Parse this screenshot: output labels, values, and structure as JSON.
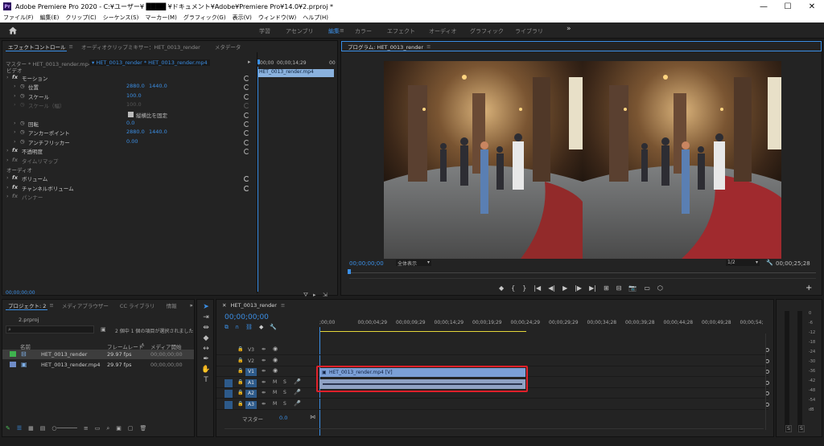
{
  "titlebar": {
    "logo_text": "Pr",
    "title": "Adobe Premiere Pro 2020 - C:¥ユーザー¥ ████ ¥ドキュメント¥Adobe¥Premiere Pro¥14.0¥2.prproj *",
    "min": "—",
    "max": "☐",
    "close": "✕"
  },
  "menu": [
    "ファイル(F)",
    "編集(E)",
    "クリップ(C)",
    "シーケンス(S)",
    "マーカー(M)",
    "グラフィック(G)",
    "表示(V)",
    "ウィンドウ(W)",
    "ヘルプ(H)"
  ],
  "workspaces": {
    "items": [
      "学習",
      "アセンブリ",
      "編集",
      "カラー",
      "エフェクト",
      "オーディオ",
      "グラフィック",
      "ライブラリ"
    ],
    "more": "»"
  },
  "effect_controls": {
    "tabs": [
      "エフェクトコントロール",
      "オーディオクリップミキサー：HET_0013_render",
      "メタデータ"
    ],
    "tab_menu": "≡",
    "master": "マスター * HET_0013_render.mp4",
    "sequence_clip": "HET_0013_render * HET_0013_render.mp4",
    "ruler_start": ";00;00",
    "ruler_mid": "00;00;14;29",
    "ruler_end": "00",
    "clip_bar": "HET_0013_render.mp4",
    "video_header": "ビデオ",
    "audio_header": "オーディオ",
    "rows": [
      {
        "kind": "group",
        "label": "モーション",
        "fx": true
      },
      {
        "kind": "prop",
        "label": "位置",
        "v1": "2880.0",
        "v2": "1440.0"
      },
      {
        "kind": "prop",
        "label": "スケール",
        "v1": "100.0",
        "v2": ""
      },
      {
        "kind": "prop-dim",
        "label": "スケール（幅）",
        "v1": "100.0",
        "v2": ""
      },
      {
        "kind": "check",
        "label": "縦横比を固定",
        "v1": "",
        "v2": ""
      },
      {
        "kind": "prop",
        "label": "回転",
        "v1": "0.0",
        "v2": ""
      },
      {
        "kind": "prop",
        "label": "アンカーポイント",
        "v1": "2880.0",
        "v2": "1440.0"
      },
      {
        "kind": "prop",
        "label": "アンチフリッカー",
        "v1": "0.00",
        "v2": ""
      },
      {
        "kind": "group",
        "label": "不透明度",
        "fx": true
      },
      {
        "kind": "group-dim",
        "label": "タイムリマップ",
        "fx": true
      },
      {
        "kind": "section",
        "label": "オーディオ"
      },
      {
        "kind": "group",
        "label": "ボリューム",
        "fx": true
      },
      {
        "kind": "group",
        "label": "チャンネルボリューム",
        "fx": true
      },
      {
        "kind": "group-dim",
        "label": "パンナー",
        "fx": true
      }
    ],
    "timecode": "00;00;00;00"
  },
  "program": {
    "title": "プログラム: HET_0013_render",
    "tab_menu": "≡",
    "timecode_left": "00;00;00;00",
    "fit": "全体表示",
    "resolution": "1/2",
    "timecode_right": "00;00;25;28",
    "transport": [
      "marker",
      "in",
      "out",
      "goto-in",
      "step-back",
      "play",
      "step-forward",
      "goto-out",
      "insert",
      "overwrite",
      "export-frame",
      "comparison",
      "vr",
      "add"
    ]
  },
  "project": {
    "tabs": [
      "プロジェクト: 2",
      "メディアブラウザー",
      "CC ライブラリ",
      "情報"
    ],
    "more": "»",
    "file": "2.prproj",
    "search_placeholder": "",
    "selection_info": "2 個中 1 個の項目が選択されました",
    "columns": [
      "名前",
      "フレームレート",
      "メディア開始"
    ],
    "items": [
      {
        "name": "HET_0013_render",
        "fps": "29.97 fps",
        "start": "00;00;00;00",
        "color": "#3fb34f",
        "selected": true
      },
      {
        "name": "HET_0013_render.mp4",
        "fps": "29.97 fps",
        "start": "00;00;00;00",
        "color": "#6f8cc7",
        "selected": false
      }
    ]
  },
  "timeline": {
    "tab": "HET_0013_render",
    "tab_menu": "≡",
    "timecode": "00;00;00;00",
    "ruler": [
      ";00;00",
      "00;00;04;29",
      "00;00;09;29",
      "00;00;14;29",
      "00;00;19;29",
      "00;00;24;29",
      "00;00;29;29",
      "00;00;34;28",
      "00;00;39;28",
      "00;00;44;28",
      "00;00;49;28",
      "00;00;54;"
    ],
    "tracks": [
      {
        "name": "V3",
        "kind": "video",
        "target": false
      },
      {
        "name": "V2",
        "kind": "video",
        "target": false
      },
      {
        "name": "V1",
        "kind": "video",
        "target": true
      },
      {
        "name": "A1",
        "kind": "audio",
        "target": true
      },
      {
        "name": "A2",
        "kind": "audio",
        "target": true
      },
      {
        "name": "A3",
        "kind": "audio",
        "target": true
      }
    ],
    "master_label": "マスター",
    "master_value": "0.0",
    "video_clip": "HET_0013_render.mp4 [V]",
    "m_label": "M",
    "s_label": "S"
  },
  "meter": {
    "scale": [
      "0",
      "-6",
      "-12",
      "-18",
      "-24",
      "-30",
      "-36",
      "-42",
      "-48",
      "-54",
      "dB"
    ],
    "solo_left": "S",
    "solo_right": "S"
  },
  "colors": {
    "accent": "#3b8fe6",
    "selection_red": "#e0202a",
    "video_clip": "#7b9fd6",
    "audio_clip": "#8fa2c4"
  }
}
